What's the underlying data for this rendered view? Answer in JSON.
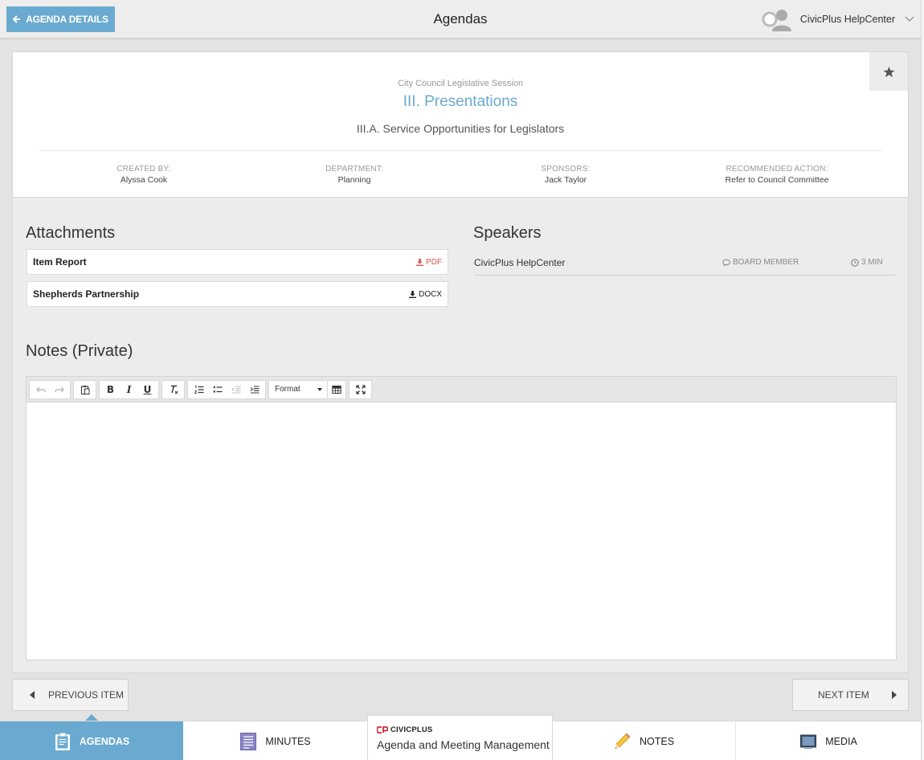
{
  "header": {
    "back_label": "AGENDA DETAILS",
    "title": "Agendas",
    "user_name": "CivicPlus HelpCenter"
  },
  "item": {
    "meeting_name": "City Council Legislative Session",
    "section_title": "III. Presentations",
    "item_title": "III.A. Service Opportunities for Legislators",
    "meta": [
      {
        "label": "CREATED BY:",
        "value": "Alyssa Cook"
      },
      {
        "label": "DEPARTMENT:",
        "value": "Planning"
      },
      {
        "label": "SPONSORS:",
        "value": "Jack Taylor"
      },
      {
        "label": "RECOMMENDED ACTION:",
        "value": "Refer to Council Committee"
      }
    ]
  },
  "attachments": {
    "heading": "Attachments",
    "items": [
      {
        "name": "Item Report",
        "type": "PDF",
        "color": "#d9534f"
      },
      {
        "name": "Shepherds Partnership",
        "type": "DOCX",
        "color": "#222222"
      }
    ]
  },
  "speakers": {
    "heading": "Speakers",
    "items": [
      {
        "name": "CivicPlus HelpCenter",
        "role": "BOARD MEMBER",
        "time": "3 MIN"
      }
    ]
  },
  "notes": {
    "heading": "Notes (Private)",
    "format_label": "Format"
  },
  "pager": {
    "prev_label": "PREVIOUS ITEM",
    "next_label": "NEXT ITEM"
  },
  "bottom_nav": {
    "agendas": "AGENDAS",
    "minutes": "MINUTES",
    "brand_logo": "CIVICPLUS",
    "brand_tagline": "Agenda and Meeting Management",
    "notes": "NOTES",
    "media": "MEDIA"
  },
  "colors": {
    "accent": "#6aaad0",
    "pdf": "#d9534f",
    "brand_red": "#cc2a36"
  }
}
